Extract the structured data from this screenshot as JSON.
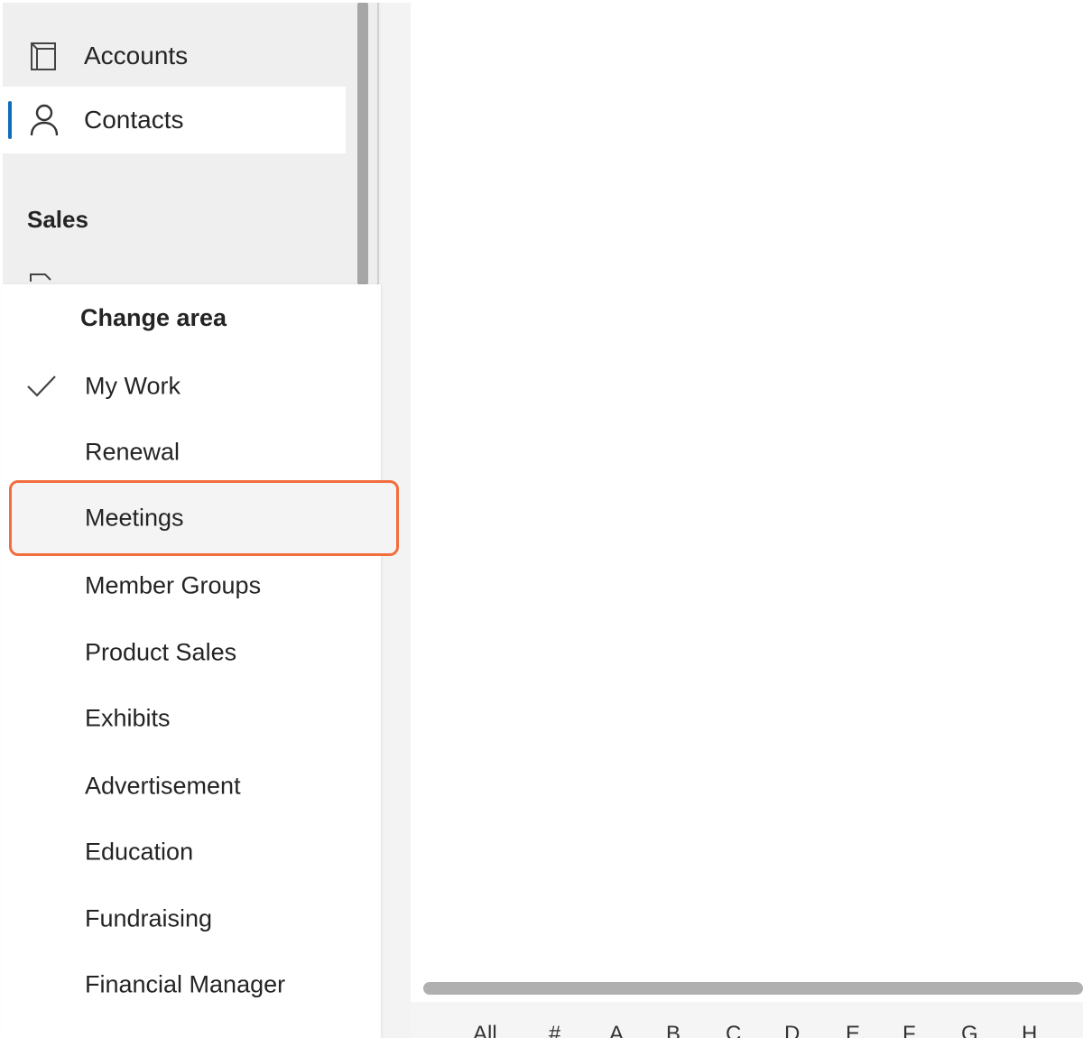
{
  "sidebar": {
    "items": [
      {
        "label": "Accounts",
        "icon": "accounts-icon",
        "active": false
      },
      {
        "label": "Contacts",
        "icon": "contact-person-icon",
        "active": true
      }
    ],
    "section_header": "Sales"
  },
  "change_area": {
    "title": "Change area",
    "items": [
      {
        "label": "My Work",
        "selected": true
      },
      {
        "label": "Renewal"
      },
      {
        "label": "Meetings",
        "hovered": true
      },
      {
        "label": "Member Groups"
      },
      {
        "label": "Product Sales"
      },
      {
        "label": "Exhibits"
      },
      {
        "label": "Advertisement"
      },
      {
        "label": "Education"
      },
      {
        "label": "Fundraising"
      },
      {
        "label": "Financial Manager"
      }
    ]
  },
  "alphabet_filter": [
    "All",
    "#",
    "A",
    "B",
    "C",
    "D",
    "E",
    "F",
    "G",
    "H"
  ],
  "colors": {
    "accent": "#0f6cbd",
    "highlight": "#f26d3d",
    "sidebar_bg": "#efefef"
  }
}
